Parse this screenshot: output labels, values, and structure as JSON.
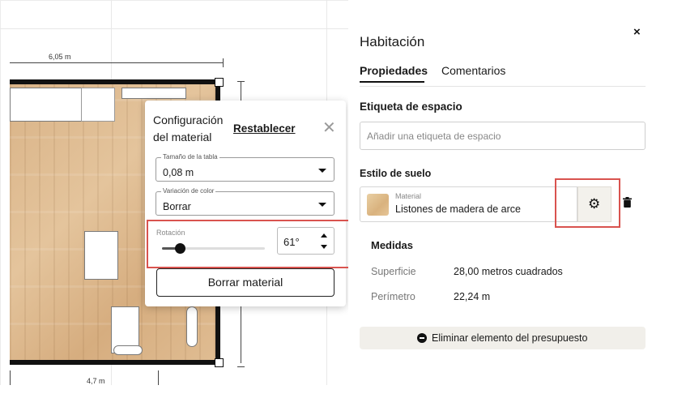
{
  "canvas": {
    "dimension_top": "6,05 m",
    "dimension_bottom": "4,7 m"
  },
  "material_popup": {
    "title": "Configuración del material",
    "reset_label": "Restablecer",
    "close_icon": "close-icon",
    "board_size": {
      "legend": "Tamaño de la tabla",
      "value": "0,08 m"
    },
    "color_variation": {
      "legend": "Variación de color",
      "value": "Borrar"
    },
    "rotation": {
      "label": "Rotación",
      "value": "61°",
      "slider_fraction": 0.17
    },
    "clear_button": "Borrar material"
  },
  "panel": {
    "title": "Habitación",
    "close_glyph": "×",
    "tabs": [
      {
        "label": "Propiedades",
        "active": true
      },
      {
        "label": "Comentarios",
        "active": false
      }
    ],
    "space_label": {
      "heading": "Etiqueta de espacio",
      "placeholder": "Añadir una etiqueta de espacio"
    },
    "floor_style": {
      "heading": "Estilo de suelo",
      "material_caption": "Material",
      "material_name": "Listones de madera de arce",
      "settings_icon": "gear-icon",
      "delete_icon": "trash-icon"
    },
    "measures": {
      "heading": "Medidas",
      "rows": [
        {
          "key": "Superficie",
          "value": "28,00 metros cuadrados"
        },
        {
          "key": "Perímetro",
          "value": "22,24 m"
        }
      ]
    },
    "remove_button": "Eliminar elemento del presupuesto"
  },
  "colors": {
    "highlight": "#d9534f",
    "floor_wood": "#dcb98e",
    "accent_button_bg": "#f1efea"
  }
}
